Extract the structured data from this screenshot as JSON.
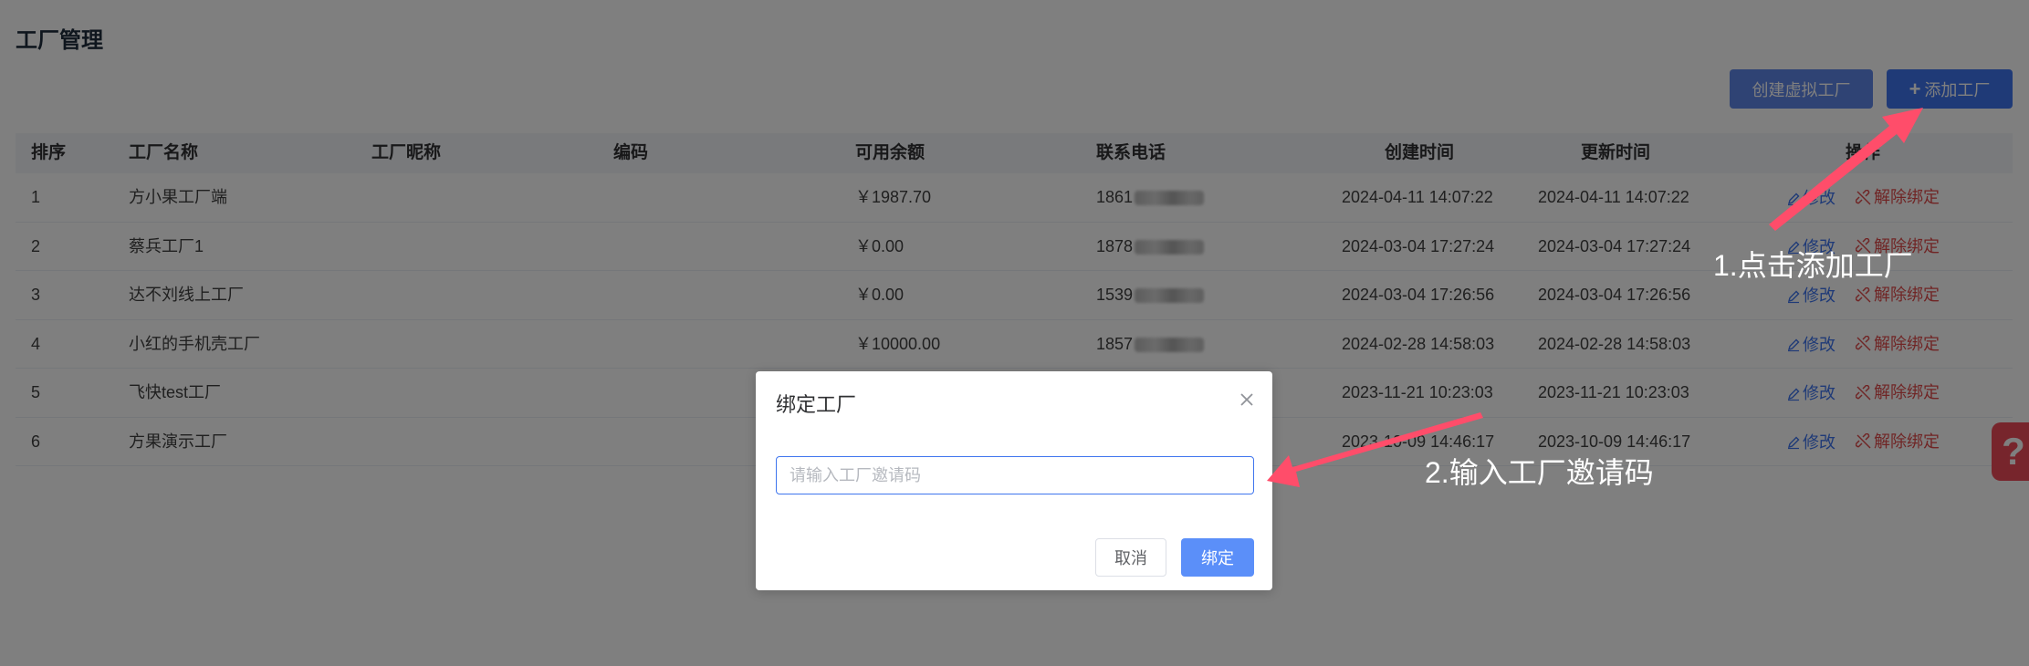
{
  "page": {
    "title": "工厂管理",
    "create_virtual_label": "创建虚拟工厂",
    "add_factory_label": "添加工厂"
  },
  "table": {
    "headers": {
      "index": "排序",
      "name": "工厂名称",
      "nickname": "工厂昵称",
      "code": "编码",
      "balance": "可用余额",
      "phone": "联系电话",
      "created": "创建时间",
      "updated": "更新时间",
      "ops": "操作"
    },
    "rows": [
      {
        "index": "1",
        "name": "方小果工厂端",
        "nickname": "",
        "code": "",
        "balance": "￥1987.70",
        "phone": "1861",
        "created": "2024-04-11 14:07:22",
        "updated": "2024-04-11 14:07:22"
      },
      {
        "index": "2",
        "name": "蔡兵工厂1",
        "nickname": "",
        "code": "",
        "balance": "￥0.00",
        "phone": "1878",
        "created": "2024-03-04 17:27:24",
        "updated": "2024-03-04 17:27:24"
      },
      {
        "index": "3",
        "name": "达不刘线上工厂",
        "nickname": "",
        "code": "",
        "balance": "￥0.00",
        "phone": "1539",
        "created": "2024-03-04 17:26:56",
        "updated": "2024-03-04 17:26:56"
      },
      {
        "index": "4",
        "name": "小红的手机壳工厂",
        "nickname": "",
        "code": "",
        "balance": "￥10000.00",
        "phone": "1857",
        "created": "2024-02-28 14:58:03",
        "updated": "2024-02-28 14:58:03"
      },
      {
        "index": "5",
        "name": "飞快test工厂",
        "nickname": "",
        "code": "",
        "balance": "",
        "phone": "",
        "created": "2023-11-21 10:23:03",
        "updated": "2023-11-21 10:23:03"
      },
      {
        "index": "6",
        "name": "方果演示工厂",
        "nickname": "",
        "code": "",
        "balance": "",
        "phone": "",
        "created": "2023-10-09 14:46:17",
        "updated": "2023-10-09 14:46:17"
      }
    ],
    "edit_label": "修改",
    "unbind_label": "解除绑定"
  },
  "dialog": {
    "title": "绑定工厂",
    "input_value": "",
    "input_placeholder": "请输入工厂邀请码",
    "cancel_label": "取消",
    "confirm_label": "绑定"
  },
  "help": {
    "label": "?"
  },
  "annotations": {
    "step1": "1.点击添加工厂",
    "step2": "2.输入工厂邀请码",
    "color": "#ff4d6a"
  },
  "colors": {
    "primary": "#3f75ee",
    "danger": "#e04a4a",
    "help": "#ef4b58"
  }
}
